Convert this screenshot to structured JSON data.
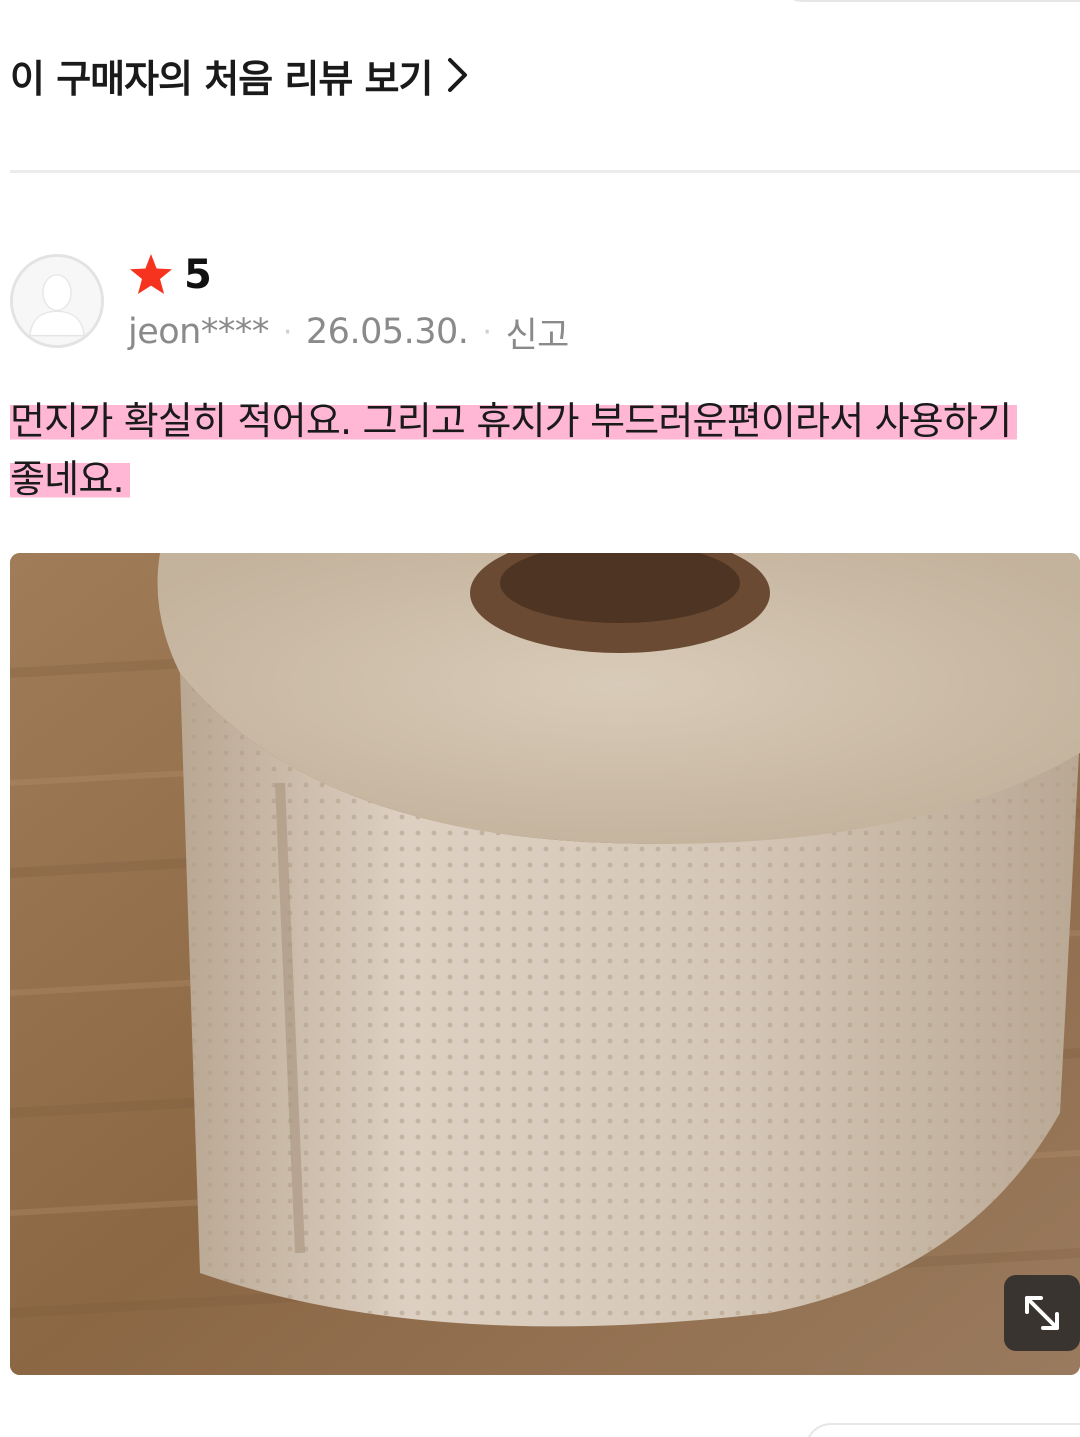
{
  "first_review_link": {
    "label": "이 구매자의 처음 리뷰 보기"
  },
  "review": {
    "rating": "5",
    "username": "jeon****",
    "date": "26.05.30.",
    "report_label": "신고",
    "text_line1": "먼지가 확실히 적어요. 그리고 휴지가 부드러운편이라서 사용하기",
    "text_line2": "좋네요.",
    "highlight_color": "#ffaacd",
    "star_color": "#f5331f"
  },
  "photo": {
    "expand_icon": "expand-icon"
  }
}
